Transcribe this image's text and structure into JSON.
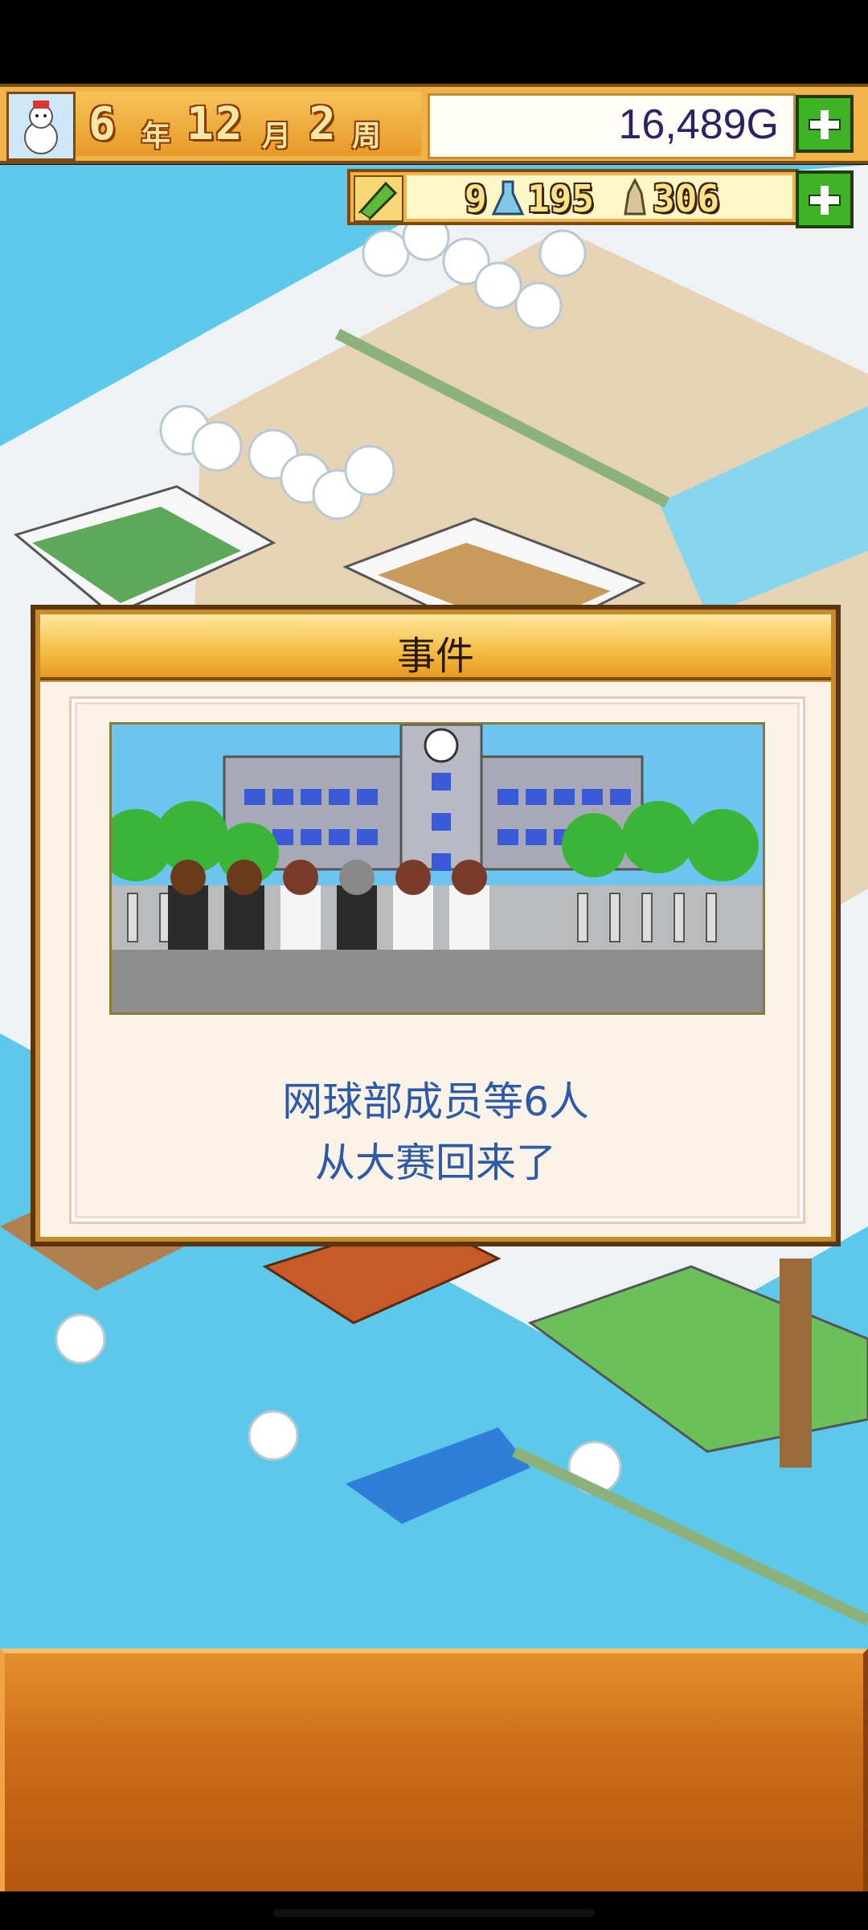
{
  "status": {
    "year": "6",
    "year_unit": "年",
    "month": "12",
    "month_unit": "月",
    "week": "2",
    "week_unit": "周",
    "money": "16,489G"
  },
  "resources": {
    "research": "9",
    "points": "195",
    "popularity": "306"
  },
  "icons": {
    "season": "snowman-icon",
    "add_money": "plus-icon",
    "pencil": "pencil-icon",
    "flask": "flask-icon",
    "tower": "tower-icon",
    "add_resources": "plus-icon"
  },
  "dialog": {
    "title": "事件",
    "message_line1": "网球部成员等6人",
    "message_line2": "从大赛回来了"
  },
  "colors": {
    "accent_orange": "#f2b24a",
    "message_blue": "#2a5aa8",
    "money_text": "#2c2366",
    "plus_green": "#3fb328"
  }
}
